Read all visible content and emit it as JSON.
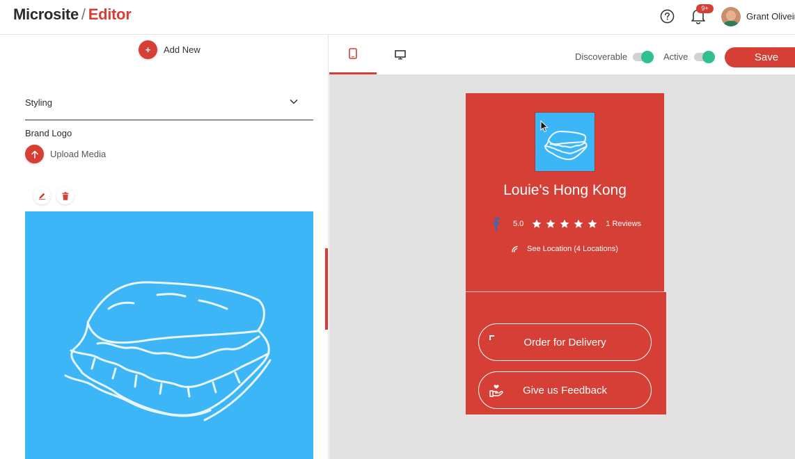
{
  "header": {
    "brand_part1": "Microsite",
    "brand_separator": "/",
    "brand_part2": "Editor",
    "notification_badge": "9+",
    "user_name": "Grant Oliveira"
  },
  "left_panel": {
    "add_new_label": "Add New",
    "styling_label": "Styling",
    "brand_logo_label": "Brand Logo",
    "upload_media_label": "Upload Media"
  },
  "toolbar": {
    "discoverable_label": "Discoverable",
    "discoverable_on": true,
    "active_label": "Active",
    "active_on": true,
    "save_label": "Save"
  },
  "microsite": {
    "name": "Louie's Hong Kong",
    "rating": "5.0",
    "stars": 5,
    "reviews": "1 Reviews",
    "location": "See Location (4 Locations)",
    "buttons": [
      {
        "label": "Order for Delivery",
        "icon": "delivery-icon"
      },
      {
        "label": "Give us Feedback",
        "icon": "feedback-icon"
      }
    ]
  },
  "colors": {
    "brand_red": "#d63f35",
    "logo_blue": "#3cb6f7",
    "toggle_green": "#2ec08e"
  }
}
